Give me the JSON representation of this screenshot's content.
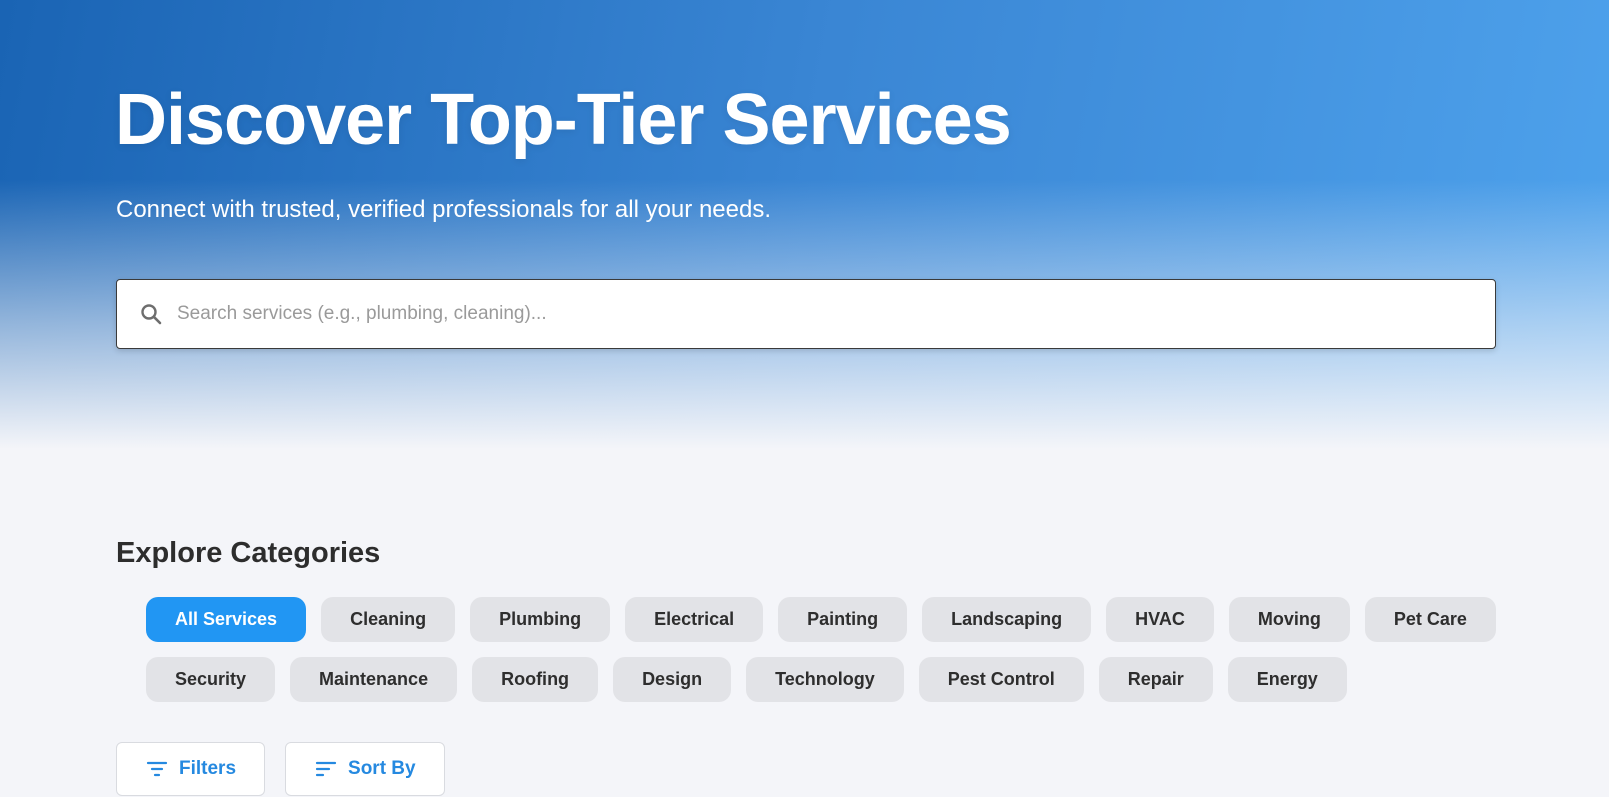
{
  "hero": {
    "title": "Discover Top-Tier Services",
    "subtitle": "Connect with trusted, verified professionals for all your needs."
  },
  "search": {
    "placeholder": "Search services (e.g., plumbing, cleaning)...",
    "value": "",
    "icon": "search-icon"
  },
  "categories": {
    "title": "Explore Categories",
    "row1": [
      "All Services",
      "Cleaning",
      "Plumbing",
      "Electrical",
      "Painting",
      "Landscaping",
      "HVAC",
      "Moving",
      "Pet Care"
    ],
    "row2": [
      "Security",
      "Maintenance",
      "Roofing",
      "Design",
      "Technology",
      "Pest Control",
      "Repair",
      "Energy"
    ],
    "active": "All Services"
  },
  "actions": {
    "filters_label": "Filters",
    "filters_icon": "filter-icon",
    "sort_label": "Sort By",
    "sort_icon": "sort-icon"
  },
  "colors": {
    "accent": "#2196f3",
    "hero_start": "#1a64b4",
    "hero_end": "#4ea2ec",
    "chip_bg": "#e2e3e7",
    "page_bg": "#f4f5f9"
  }
}
